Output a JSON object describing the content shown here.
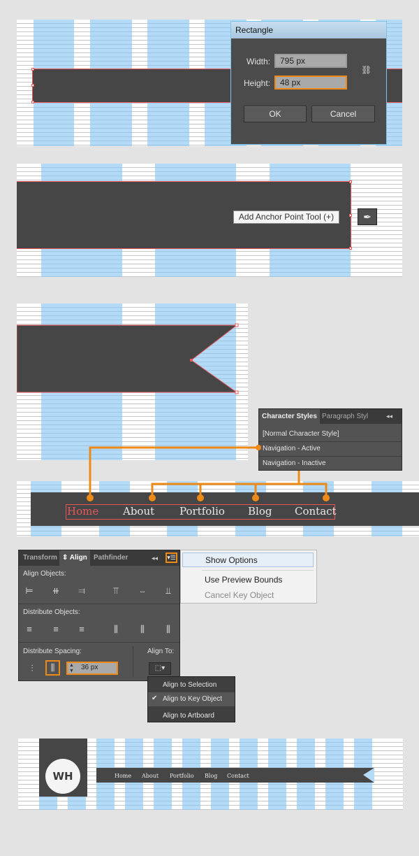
{
  "rectangle_dialog": {
    "title": "Rectangle",
    "width_label": "Width:",
    "width_value": "795 px",
    "height_label": "Height:",
    "height_value": "48 px",
    "ok": "OK",
    "cancel": "Cancel"
  },
  "anchor_tooltip": "Add Anchor Point Tool (+)",
  "character_styles": {
    "tab_active": "Character Styles",
    "tab_inactive": "Paragraph Styl",
    "items": [
      "[Normal Character Style]",
      "Navigation - Active",
      "Navigation - Inactive"
    ]
  },
  "nav": {
    "items": [
      "Home",
      "About",
      "Portfolio",
      "Blog",
      "Contact"
    ],
    "active_color": "#e8585b"
  },
  "align_panel": {
    "tabs": [
      "Transform",
      "Align",
      "Pathfinder"
    ],
    "align_objects": "Align Objects:",
    "distribute_objects": "Distribute Objects:",
    "distribute_spacing": "Distribute Spacing:",
    "align_to": "Align To:",
    "spacing_value": "36 px"
  },
  "options_menu": {
    "items": [
      "Show Options",
      "Use Preview Bounds",
      "Cancel Key Object"
    ]
  },
  "align_to_menu": {
    "items": [
      "Align to Selection",
      "Align to Key Object",
      "Align to Artboard"
    ],
    "checked": "Align to Key Object"
  },
  "final": {
    "logo": "WH",
    "nav": [
      "Home",
      "About",
      "Portfolio",
      "Blog",
      "Contact"
    ]
  },
  "colors": {
    "accent_orange": "#ee8a17",
    "selection_red": "#e8585b",
    "grid_blue": "#b3dbf7",
    "dark_gray": "#464646"
  }
}
